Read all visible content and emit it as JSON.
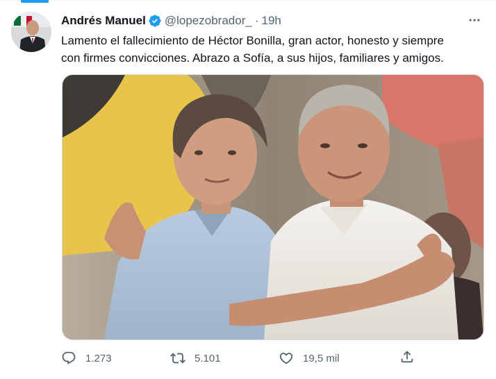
{
  "tweet": {
    "author_name": "Andrés Manuel",
    "handle": "@lopezobrador_",
    "separator": "·",
    "time": "19h",
    "text": "Lamento el fallecimiento de Héctor Bonilla, gran actor, honesto y siempre\ncon firmes convicciones. Abrazo a Sofía, a sus hijos, familiares y amigos.",
    "image_description": "photo of two men embracing",
    "verified": true
  },
  "actions": {
    "reply_count": "1.273",
    "retweet_count": "5.101",
    "like_count": "19,5 mil"
  },
  "icons": {
    "reply": "comment-icon",
    "retweet": "retweet-icon",
    "like": "heart-icon",
    "share": "share-icon",
    "verified": "verified-badge-icon",
    "more": "more-icon"
  },
  "colors": {
    "accent": "#1d9bf0",
    "text": "#0f1419",
    "secondary": "#536471"
  }
}
